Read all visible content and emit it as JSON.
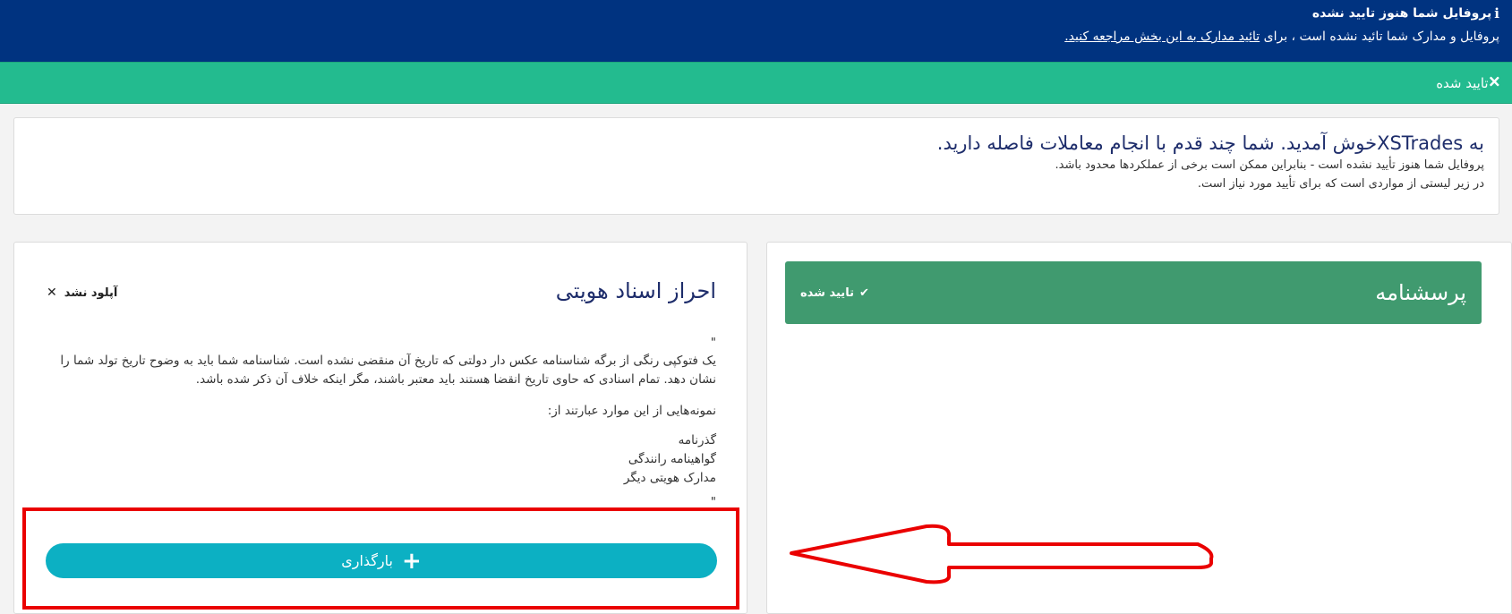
{
  "notice": {
    "title": "پروفایل شما هنوز تایید نشده",
    "info_icon": "i",
    "body_prefix": "پروفایل و مدارک شما تائید نشده است ، برای ",
    "link_text": "تائید مدارک به این بخش مراجعه کنید."
  },
  "banner": {
    "close_icon": "🗙",
    "text": "تایید شده"
  },
  "welcome": {
    "title": "به XSTradesخوش آمدید. شما چند قدم با انجام معاملات فاصله دارید.",
    "line1": "پروفایل شما هنوز تأیید نشده است - بنابراین ممکن است برخی از عملکردها محدود باشد.",
    "line2": "در زیر لیستی از مواردی است که برای تأیید مورد نیاز است."
  },
  "identity": {
    "title": "احراز اسناد هویتی",
    "status_icon": "✕",
    "status_text": "آپلود نشد",
    "quote_open": "\"",
    "paragraph": "یک فتوکپی رنگی از برگه شناسنامه عکس دار دولتی که تاریخ آن منقضی نشده است. شناسنامه شما باید به وضوح تاریخ تولد شما را نشان دهد. تمام اسنادی که حاوی تاریخ انقضا هستند باید معتبر باشند، مگر اینکه خلاف آن ذکر شده باشد.",
    "examples_label": "نمونه‌هایی از این موارد عبارتند از:",
    "examples": [
      "گذرنامه",
      "گواهینامه رانندگی",
      "مدارک هویتی دیگر"
    ],
    "quote_close": "\"",
    "upload_icon": "+",
    "upload_label": "بارگذاری"
  },
  "questionnaire": {
    "title": "پرسشنامه",
    "status_icon": "✔",
    "status_text": "تایید شده"
  },
  "colors": {
    "notice_bg": "#003380",
    "banner_bg": "#23bb8f",
    "questionnaire_bar": "#409a6f",
    "upload_button": "#0cb0c3",
    "annotation": "#ea0000"
  }
}
